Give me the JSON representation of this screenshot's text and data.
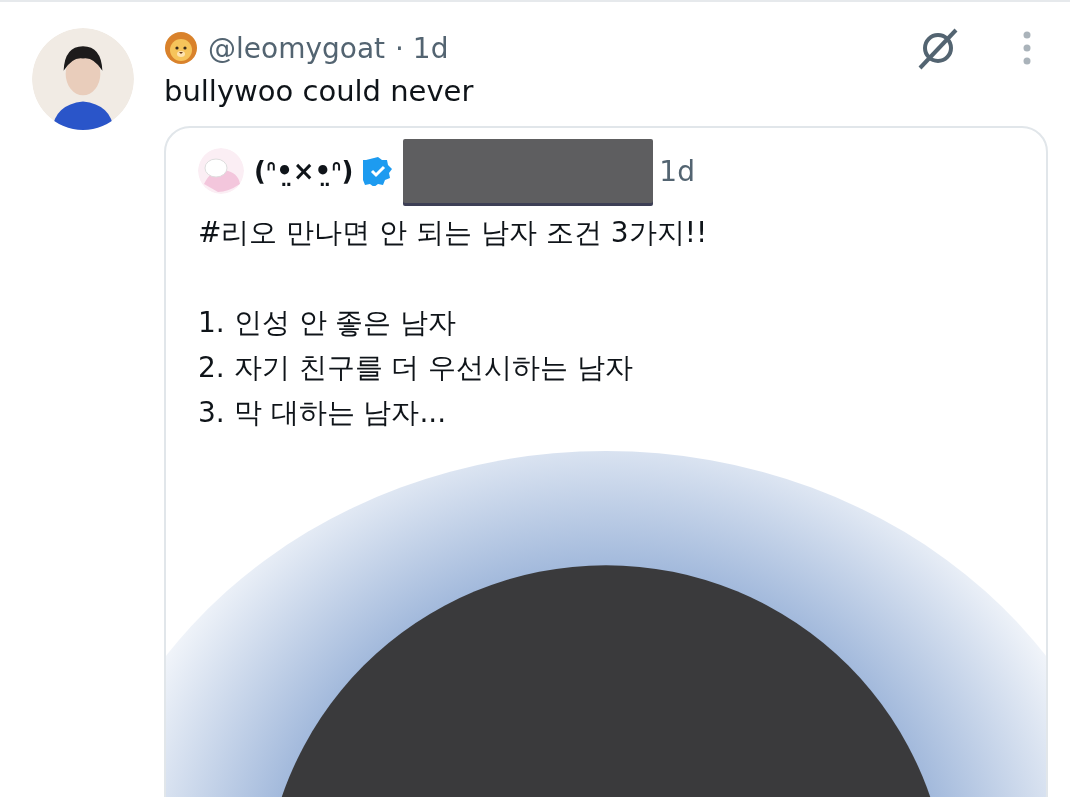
{
  "post": {
    "handle": "@leomygoat",
    "time": "· 1d",
    "text": "bullywoo could never"
  },
  "quote": {
    "display_name": "(ᐢ•̤×•̤ᐢ)",
    "verified": true,
    "time": "1d",
    "heading": "#리오 만나면 안 되는 남자 조건 3가지!!",
    "lines": [
      "1. 인성 안 좋은 남자",
      "2. 자기 친구를 더 우선시하는 남자",
      "3. 막 대하는 남자..."
    ]
  }
}
